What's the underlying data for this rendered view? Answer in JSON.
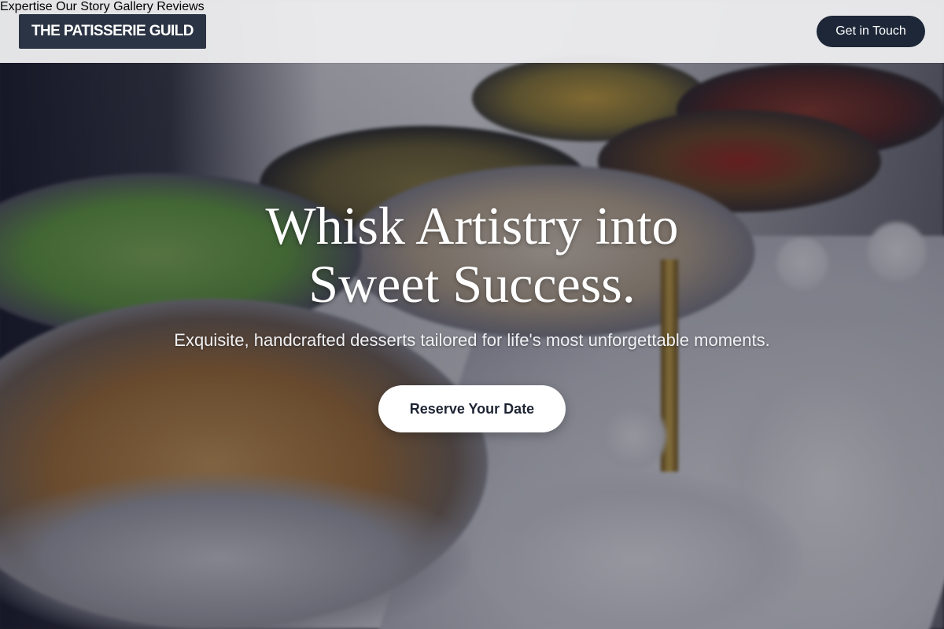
{
  "header": {
    "logo_text": "THE PATISSERIE GUILD",
    "nav": [
      {
        "label": "Expertise"
      },
      {
        "label": "Our Story"
      },
      {
        "label": "Gallery"
      },
      {
        "label": "Reviews"
      }
    ],
    "cta_label": "Get in Touch"
  },
  "hero": {
    "headline_line1": "Whisk Artistry into",
    "headline_line2": "Sweet Success.",
    "subheadline": "Exquisite, handcrafted desserts tailored for life's most unforgettable moments.",
    "button_label": "Reserve Your Date"
  },
  "colors": {
    "logo_bg": "#2b3444",
    "cta_bg": "#1d2738",
    "nav_text": "#4a5568",
    "header_bg": "#ececee"
  }
}
